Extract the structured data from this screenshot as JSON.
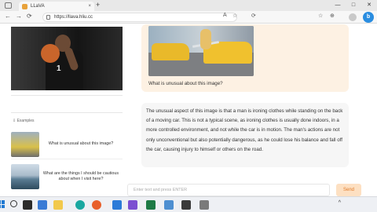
{
  "browser": {
    "tab_title": "LLaVA",
    "url": "https://llava.hliu.cc",
    "new_tab_symbol": "+",
    "tab_close_symbol": "×",
    "window_controls": [
      "—",
      "□",
      "✕"
    ],
    "nav_symbols": [
      "←",
      "→",
      "⟳"
    ],
    "right_icons": [
      "A",
      "☆",
      "⟳",
      "☆",
      "⊕"
    ],
    "edge_badge": "b"
  },
  "examples": {
    "label": "⇩ Examples",
    "items": [
      {
        "question": "What is unusual about this image?"
      },
      {
        "question": "What are the things I should be cautious about when I visit here?"
      }
    ]
  },
  "chat": {
    "user_question": "What is unusual about this image?",
    "bot_answer": "The unusual aspect of this image is that a man is ironing clothes while standing on the back of a moving car. This is not a typical scene, as ironing clothes is usually done indoors, in a more controlled environment, and not while the car is in motion. The man's actions are not only unconventional but also potentially dangerous, as he could lose his balance and fall off the car, causing injury to himself or others on the road."
  },
  "input": {
    "placeholder": "Enter text and press ENTER",
    "send_label": "Send"
  },
  "taskbar": {
    "chevron": "^",
    "icons": [
      "windows-icon",
      "search-icon",
      "task-view-icon",
      "widgets-icon",
      "file-explorer-icon",
      "edge-icon",
      "firefox-icon",
      "store-icon",
      "vscode-icon",
      "visual-studio-icon",
      "excel-icon",
      "notepad-icon",
      "terminal-icon",
      "settings-icon"
    ]
  },
  "colors": {
    "send_text": "#e07a2a",
    "send_bg": "#fde0c2",
    "user_bubble": "#fdf1e3",
    "bot_bubble": "#f6f6f6",
    "accent_blue": "#1f78d1"
  }
}
